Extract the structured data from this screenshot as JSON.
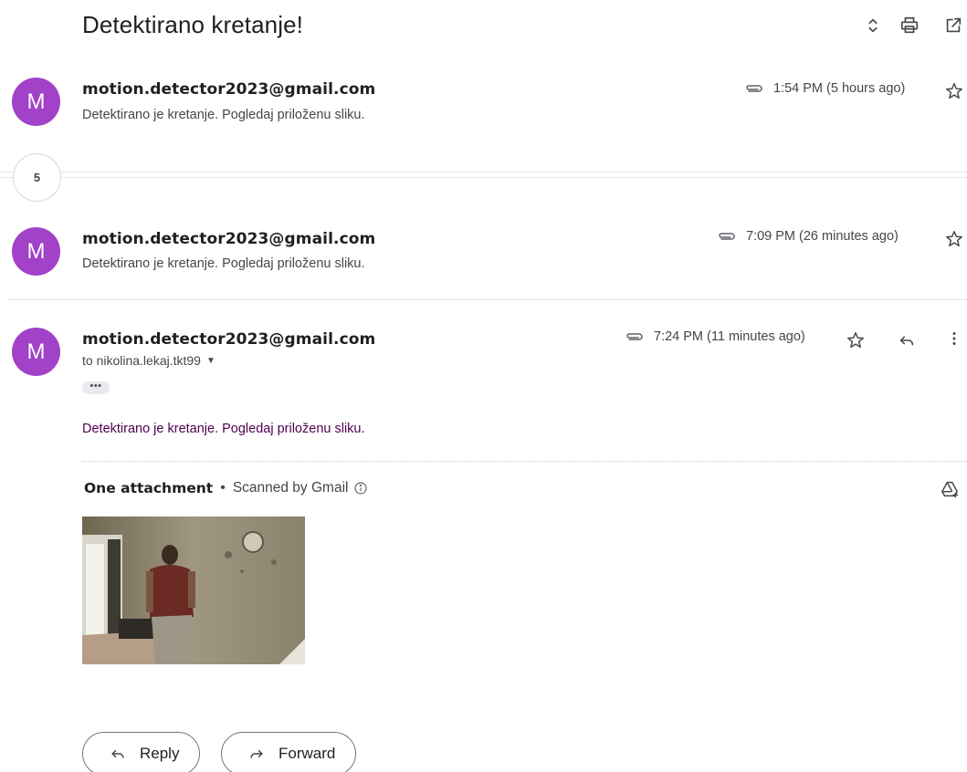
{
  "thread": {
    "subject": "Detektirano kretanje!",
    "collapsed_count": "5"
  },
  "messages": [
    {
      "avatar_letter": "M",
      "sender": "motion.detector2023@gmail.com",
      "snippet": "Detektirano je kretanje. Pogledaj priloženu sliku.",
      "time": "1:54 PM (5 hours ago)"
    },
    {
      "avatar_letter": "M",
      "sender": "motion.detector2023@gmail.com",
      "snippet": "Detektirano je kretanje. Pogledaj priloženu sliku.",
      "time": "7:09 PM (26 minutes ago)"
    },
    {
      "avatar_letter": "M",
      "sender": "motion.detector2023@gmail.com",
      "to": "to nikolina.lekaj.tkt99",
      "time": "7:24 PM (11 minutes ago)",
      "body": "Detektirano je kretanje. Pogledaj priloženu sliku.",
      "more_dots": "•••"
    }
  ],
  "attachments": {
    "title": "One attachment",
    "separator": "•",
    "scanned": "Scanned by Gmail"
  },
  "actions": {
    "reply": "Reply",
    "forward": "Forward"
  },
  "colors": {
    "avatar": "#a142c8",
    "quoted_body": "#500050"
  },
  "icons": [
    "expand-collapse-icon",
    "print-icon",
    "open-in-new-window-icon",
    "attachment-clip-icon",
    "star-icon",
    "reply-icon",
    "more-vert-icon",
    "info-icon",
    "add-to-drive-icon",
    "forward-icon"
  ]
}
